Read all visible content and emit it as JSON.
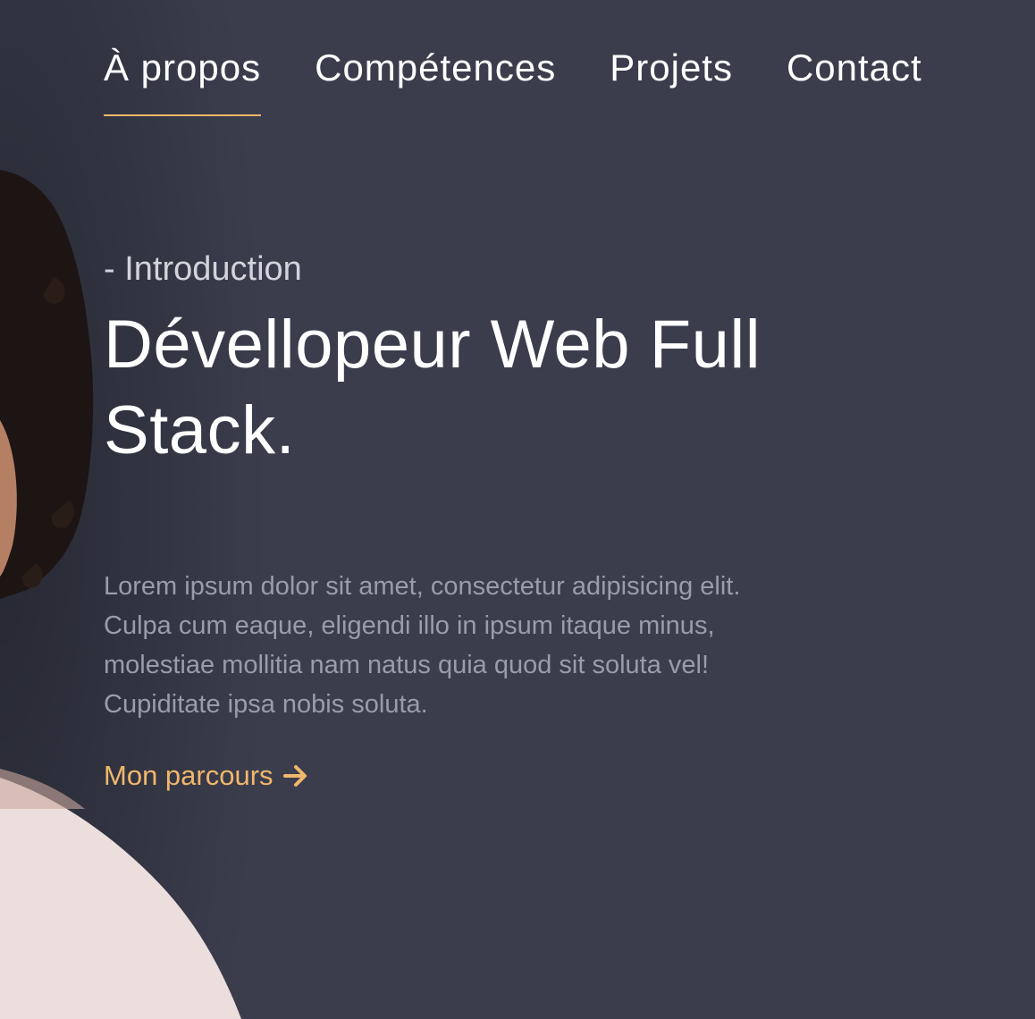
{
  "nav": {
    "items": [
      {
        "label": "À propos",
        "active": true
      },
      {
        "label": "Compétences",
        "active": false
      },
      {
        "label": "Projets",
        "active": false
      },
      {
        "label": "Contact",
        "active": false
      }
    ]
  },
  "hero": {
    "eyebrow": "- Introduction",
    "title_line1": "Dévellopeur Web Full",
    "title_line2": "Stack.",
    "description_lines": [
      "Lorem ipsum dolor sit amet, consectetur adipisicing elit.",
      "Culpa cum eaque, eligendi illo in ipsum itaque minus,",
      "molestiae mollitia nam natus quia quod sit soluta vel!",
      "Cupiditate ipsa nobis soluta."
    ],
    "cta_label": "Mon parcours",
    "cta_icon": "arrow-right-icon"
  },
  "colors": {
    "background": "#3b3d4d",
    "accent": "#f0b76c",
    "text_primary": "#ffffff",
    "text_secondary": "#d3d4da",
    "text_muted": "#9a9ca7"
  }
}
